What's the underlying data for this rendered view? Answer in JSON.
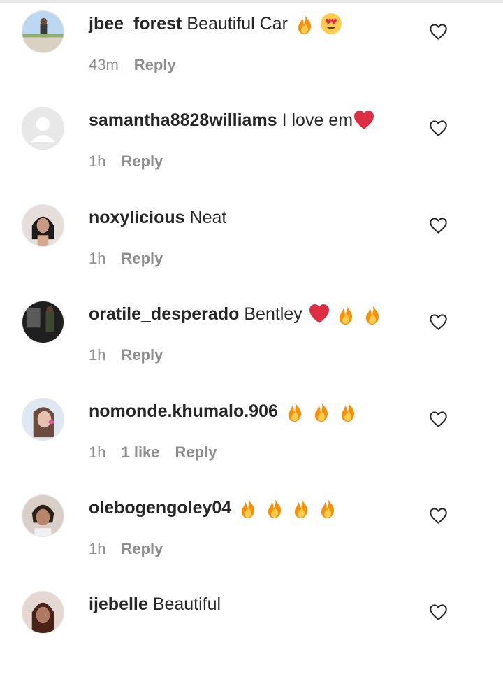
{
  "comments": [
    {
      "username": "jbee_forest",
      "text": "Beautiful Car",
      "emojis": [
        "fire",
        "heart-eyes"
      ],
      "time": "43m",
      "likes": "",
      "reply_label": "Reply"
    },
    {
      "username": "samantha8828williams",
      "text": "I love em",
      "emojis": [
        "red-heart"
      ],
      "time": "1h",
      "likes": "",
      "reply_label": "Reply"
    },
    {
      "username": "noxylicious",
      "text": "Neat",
      "emojis": [],
      "time": "1h",
      "likes": "",
      "reply_label": "Reply"
    },
    {
      "username": "oratile_desperado",
      "text": "Bentley",
      "emojis": [
        "red-heart",
        "fire",
        "fire"
      ],
      "time": "1h",
      "likes": "",
      "reply_label": "Reply"
    },
    {
      "username": "nomonde.khumalo.906",
      "text": "",
      "emojis": [
        "fire",
        "fire",
        "fire"
      ],
      "time": "1h",
      "likes": "1 like",
      "reply_label": "Reply"
    },
    {
      "username": "olebogengoley04",
      "text": "",
      "emojis": [
        "fire",
        "fire",
        "fire",
        "fire"
      ],
      "time": "1h",
      "likes": "",
      "reply_label": "Reply"
    },
    {
      "username": "ijebelle",
      "text": "Beautiful",
      "emojis": [],
      "time": "",
      "likes": "",
      "reply_label": ""
    }
  ],
  "colors": {
    "username": "#262626",
    "meta": "#8e8e8e",
    "heart_outline": "#262626",
    "fire": "#f4900c",
    "red_heart": "#dd2e44"
  },
  "icons": {
    "like": "heart-outline-icon",
    "fire": "fire-emoji",
    "heart-eyes": "heart-eyes-emoji",
    "red-heart": "red-heart-emoji"
  }
}
